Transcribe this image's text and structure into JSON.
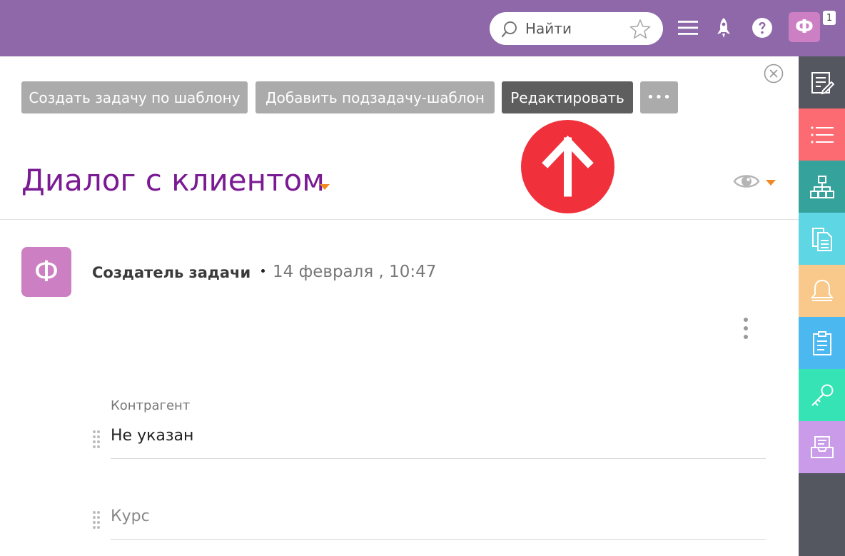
{
  "topbar": {
    "search_placeholder": "Найти",
    "user_initial": "Ф",
    "notification_count": "1"
  },
  "actions": {
    "create_from_template": "Создать задачу по шаблону",
    "add_subtask_template": "Добавить подзадачу-шаблон",
    "edit": "Редактировать",
    "more": "•••"
  },
  "task": {
    "title": "Диалог с клиентом"
  },
  "comment": {
    "avatar_initial": "Ф",
    "author": "Создатель задачи",
    "date": "14 февраля , 10:47"
  },
  "fields": [
    {
      "label": "Контрагент",
      "value": "Не указан"
    },
    {
      "placeholder": "Курс"
    }
  ],
  "colors": {
    "topbar": "#8e68a8",
    "accent_purple": "#7a1b93",
    "avatar": "#cc7fc3",
    "annotation_red": "#f0313c",
    "sidebar_bg": "#545660",
    "sidebar_items": [
      "#545660",
      "#fd6b72",
      "#36a29c",
      "#5fd6e3",
      "#f8c98b",
      "#4bb8f0",
      "#36e3b4",
      "#c99be8"
    ]
  },
  "icons": {
    "sidebar": [
      "edit-note-icon",
      "list-icon",
      "hierarchy-icon",
      "documents-icon",
      "bell-icon",
      "clipboard-icon",
      "key-icon",
      "inbox-icon"
    ]
  }
}
